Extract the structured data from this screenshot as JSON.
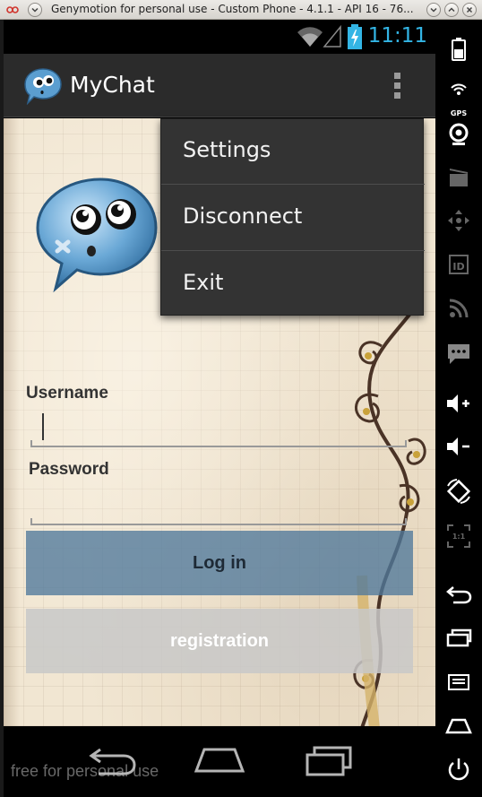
{
  "window": {
    "title": "Genymotion for personal use - Custom Phone - 4.1.1 - API 16 - 76..."
  },
  "statusbar": {
    "time": "11:11",
    "accent_color": "#33b5e5"
  },
  "actionbar": {
    "title": "MyChat",
    "overflow_icon": "overflow-menu-icon"
  },
  "menu": {
    "items": [
      {
        "label": "Settings"
      },
      {
        "label": "Disconnect"
      },
      {
        "label": "Exit"
      }
    ]
  },
  "form": {
    "username_label": "Username",
    "username_value": "",
    "password_label": "Password",
    "password_value": "",
    "login_label": "Log in",
    "registration_label": "registration"
  },
  "navbar": {
    "watermark": "free for personal use",
    "icons": [
      "back-icon",
      "home-icon",
      "recent-apps-icon"
    ]
  },
  "sidebar": {
    "gps_label": "GPS",
    "id_label": "ID",
    "rotate_label": "1:1",
    "icons": [
      "battery-icon",
      "gps-icon",
      "camera-icon",
      "video-icon",
      "dpad-icon",
      "id-icon",
      "rss-icon",
      "sms-icon",
      "volume-up-icon",
      "volume-down-icon",
      "rotate-icon",
      "scale-icon",
      "back-icon",
      "recent-apps-icon",
      "menu-icon",
      "home-icon",
      "power-icon"
    ]
  },
  "colors": {
    "login_button": "#50789b",
    "registration_button": "#c8c8c8",
    "menu_background": "#333333"
  }
}
